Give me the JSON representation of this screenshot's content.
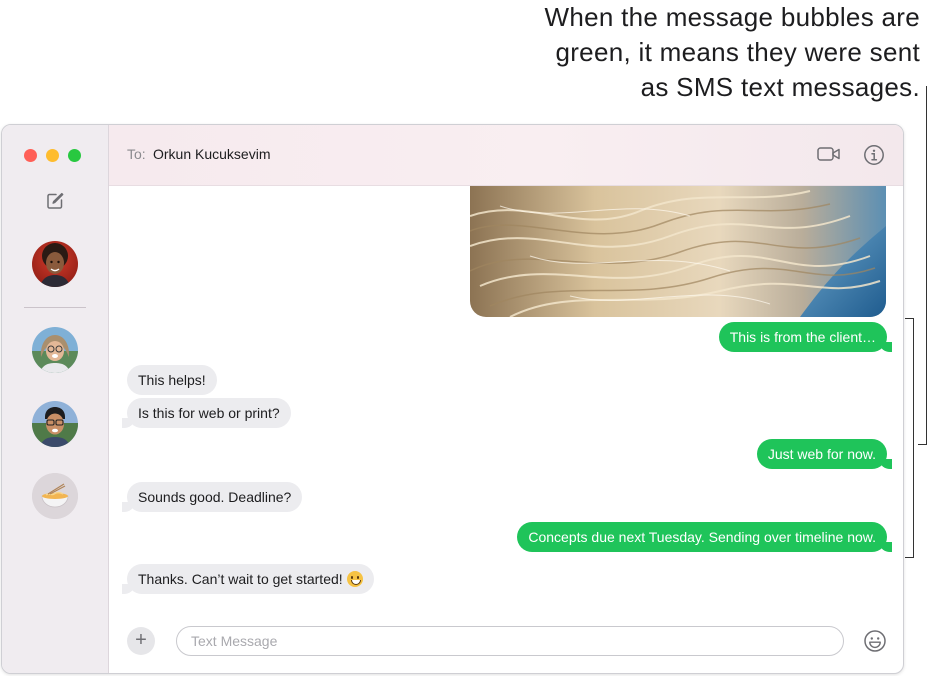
{
  "callout": {
    "line1": "When the message bubbles are",
    "line2": "green, it means they were sent",
    "line3": "as SMS text messages."
  },
  "window": {
    "sidebar": {
      "icons": [
        "close-window",
        "minimize-window",
        "zoom-window",
        "compose-icon"
      ],
      "conversations": [
        {
          "name": "avatar-orkun",
          "selected": true
        },
        {
          "name": "avatar-woman-glasses"
        },
        {
          "name": "avatar-man-glasses"
        },
        {
          "name": "avatar-noodles"
        }
      ]
    },
    "header": {
      "to_label": "To:",
      "recipient": "Orkun Kucuksevim",
      "icons": [
        "video-icon",
        "info-icon"
      ]
    },
    "messages": [
      {
        "type": "out",
        "text": "This is from the client…"
      },
      {
        "type": "in",
        "text": "This helps!"
      },
      {
        "type": "in",
        "text": "Is this for web or print?"
      },
      {
        "type": "out",
        "text": "Just web for now."
      },
      {
        "type": "in",
        "text": "Sounds good. Deadline?"
      },
      {
        "type": "out",
        "text": "Concepts due next Tuesday. Sending over timeline now."
      },
      {
        "type": "in",
        "text": "Thanks. Can’t wait to get started!",
        "emoji": "grinning-emoji"
      }
    ],
    "composer": {
      "placeholder": "Text Message",
      "value": ""
    }
  },
  "colors": {
    "sms_bubble": "#1fc45a",
    "incoming_bubble": "#ececef",
    "sidebar": "#f0ecf0",
    "header": "#f7ebef"
  }
}
